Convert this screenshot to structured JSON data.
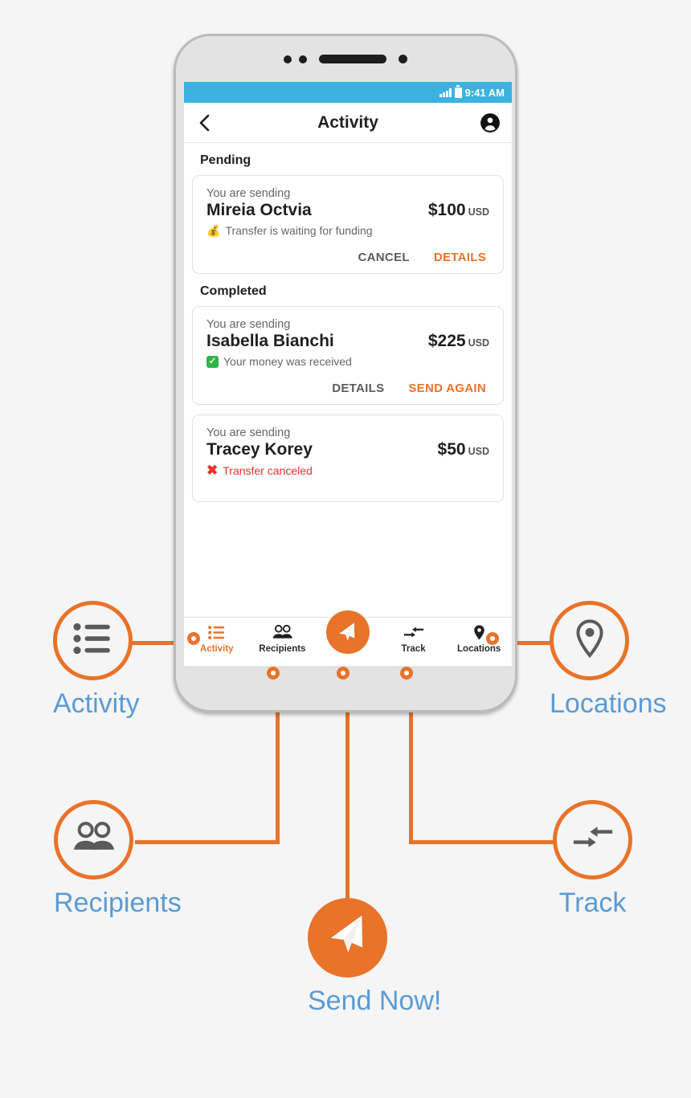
{
  "background_color": "#f5f5f5",
  "accent_color": "#e87329",
  "callout_label_color": "#5b9bd5",
  "statusbar_color": "#3bb3e0",
  "phone": {
    "statusbar": {
      "time": "9:41 AM",
      "signal_icon": "signal-bars-icon",
      "battery_icon": "battery-icon"
    },
    "appbar": {
      "back_icon": "back-chevron-icon",
      "title": "Activity",
      "profile_icon": "account-circle-icon"
    },
    "sections": [
      {
        "heading": "Pending",
        "cards": [
          {
            "sublabel": "You are sending",
            "name": "Mireia Octvia",
            "amount": "$100",
            "currency": "USD",
            "status_icon": "money-bag-emoji",
            "status_text": "Transfer is waiting for funding",
            "status_kind": "pending",
            "actions": [
              {
                "label": "CANCEL",
                "primary": false
              },
              {
                "label": "DETAILS",
                "primary": true
              }
            ]
          }
        ]
      },
      {
        "heading": "Completed",
        "cards": [
          {
            "sublabel": "You are sending",
            "name": "Isabella Bianchi",
            "amount": "$225",
            "currency": "USD",
            "status_icon": "green-check-icon",
            "status_text": "Your money was received",
            "status_kind": "received",
            "actions": [
              {
                "label": "DETAILS",
                "primary": false
              },
              {
                "label": "SEND AGAIN",
                "primary": true
              }
            ]
          },
          {
            "sublabel": "You are sending",
            "name": "Tracey Korey",
            "amount": "$50",
            "currency": "USD",
            "status_icon": "red-x-icon",
            "status_text": "Transfer canceled",
            "status_kind": "canceled",
            "actions": []
          }
        ]
      }
    ],
    "tabs": [
      {
        "label": "Activity",
        "icon": "list-icon",
        "active": true
      },
      {
        "label": "Recipients",
        "icon": "people-icon",
        "active": false
      },
      {
        "label": "Send",
        "icon": "paper-plane-icon",
        "active": false
      },
      {
        "label": "Track",
        "icon": "track-arrows-icon",
        "active": false
      },
      {
        "label": "Locations",
        "icon": "map-pin-icon",
        "active": false
      }
    ]
  },
  "callouts": [
    {
      "id": "activity",
      "label": "Activity",
      "icon": "list-icon"
    },
    {
      "id": "locations",
      "label": "Locations",
      "icon": "map-pin-icon"
    },
    {
      "id": "recipients",
      "label": "Recipients",
      "icon": "people-icon"
    },
    {
      "id": "track",
      "label": "Track",
      "icon": "track-arrows-icon"
    },
    {
      "id": "send",
      "label": "Send Now!",
      "icon": "paper-plane-icon"
    }
  ]
}
